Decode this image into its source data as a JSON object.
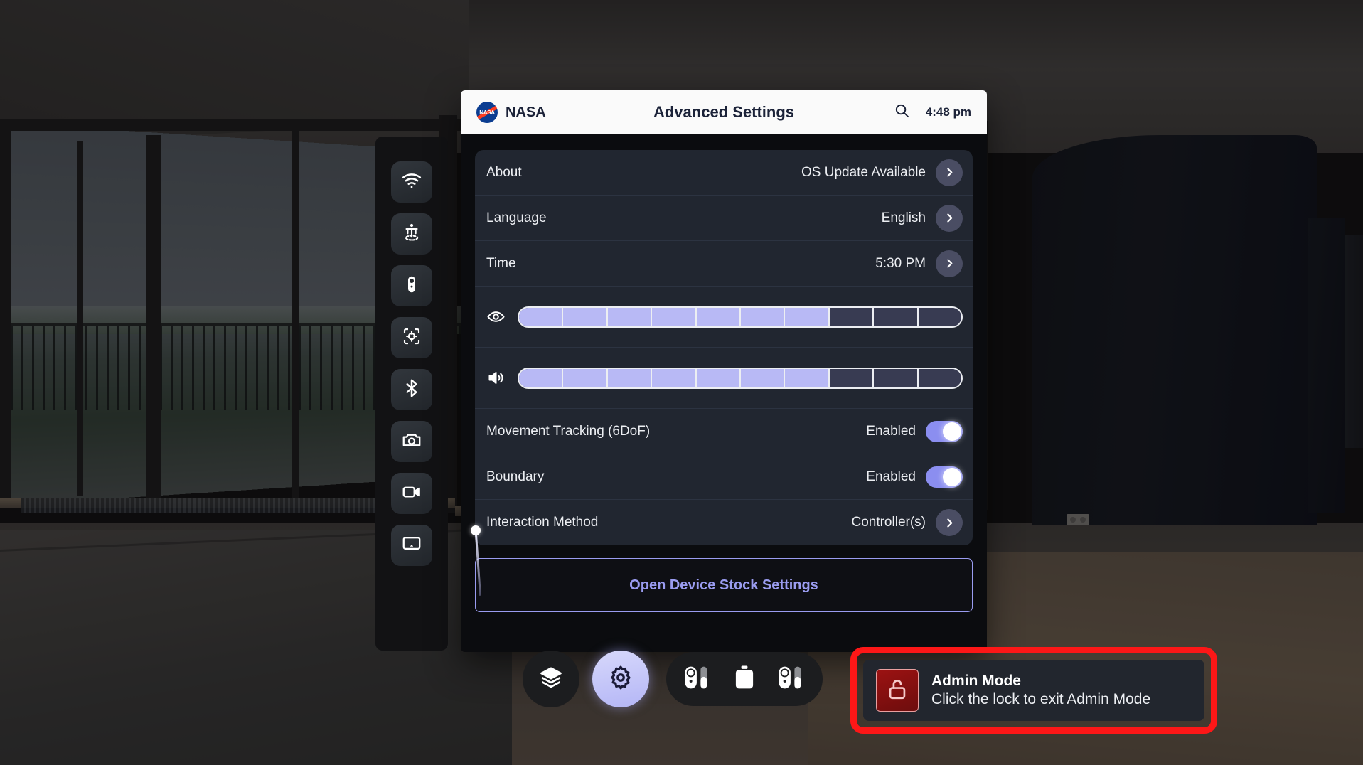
{
  "colors": {
    "accent_purple": "#8b8ef0",
    "slider_fill": "#b8b9f5",
    "slider_empty": "#383b52",
    "alert_red": "#fd1717",
    "card_bg": "#212630",
    "panel_bg": "#0b0c0f",
    "titlebar_bg": "#fafafa",
    "nasa_blue": "#0b3d91",
    "nasa_red": "#fc3d21"
  },
  "titlebar": {
    "logo_name": "nasa-meatball-logo",
    "logo_text": "NASA",
    "brand": "NASA",
    "title": "Advanced Settings",
    "search_icon": "search-icon",
    "time": "4:48 pm"
  },
  "settings_rows": [
    {
      "label": "About",
      "value": "OS Update Available",
      "control": "chevron"
    },
    {
      "label": "Language",
      "value": "English",
      "control": "chevron"
    },
    {
      "label": "Time",
      "value": "5:30 PM",
      "control": "chevron"
    }
  ],
  "sliders": [
    {
      "name": "brightness-slider",
      "icon": "eye-icon",
      "segments": 10,
      "filled": 7
    },
    {
      "name": "volume-slider",
      "icon": "speaker-icon",
      "segments": 10,
      "filled": 7
    }
  ],
  "toggle_rows": [
    {
      "label": "Movement Tracking (6DoF)",
      "value": "Enabled",
      "on": true
    },
    {
      "label": "Boundary",
      "value": "Enabled",
      "on": true
    }
  ],
  "interaction_row": {
    "label": "Interaction Method",
    "value": "Controller(s)",
    "control": "chevron"
  },
  "stock_button": {
    "label": "Open Device Stock Settings"
  },
  "tool_dock": {
    "items": [
      {
        "name": "wifi-icon",
        "label": "Wi-Fi"
      },
      {
        "name": "boundary-icon",
        "label": "Boundary / Guardian"
      },
      {
        "name": "controller-icon",
        "label": "Controller"
      },
      {
        "name": "recenter-icon",
        "label": "Recenter View"
      },
      {
        "name": "bluetooth-icon",
        "label": "Bluetooth"
      },
      {
        "name": "camera-icon",
        "label": "Screenshot"
      },
      {
        "name": "video-icon",
        "label": "Record Video"
      },
      {
        "name": "cast-icon",
        "label": "Cast"
      }
    ]
  },
  "bottom_dock": {
    "layers_button": {
      "name": "layers-icon",
      "label": "Layers"
    },
    "settings_button": {
      "name": "gear-icon",
      "label": "Settings",
      "active": true
    },
    "battery_items": [
      {
        "name": "left-controller-battery-icon",
        "label": "Left Controller"
      },
      {
        "name": "headset-battery-icon",
        "label": "Headset"
      },
      {
        "name": "right-controller-battery-icon",
        "label": "Right Controller"
      }
    ]
  },
  "admin_toast": {
    "icon": "unlocked-padlock-icon",
    "title": "Admin Mode",
    "subtitle": "Click the lock to exit Admin Mode"
  },
  "cursor": {
    "name": "laser-pointer-cursor"
  }
}
